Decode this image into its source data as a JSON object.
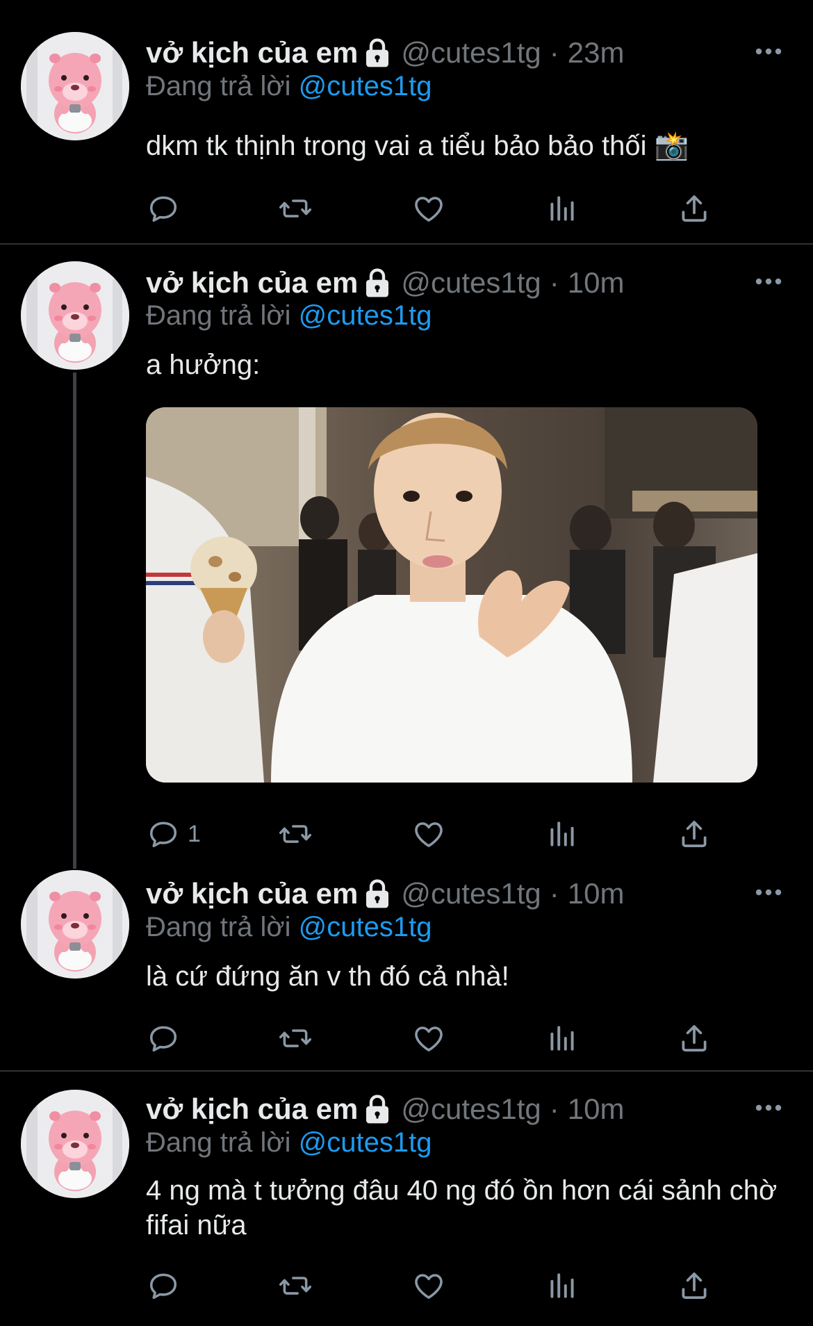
{
  "tweets": [
    {
      "display_name": "vở kịch của em",
      "handle": "@cutes1tg",
      "separator": "·",
      "time": "23m",
      "replying_prefix": "Đang trả lời",
      "replying_to": "@cutes1tg",
      "text": "dkm tk thịnh trong vai a tiểu bảo bảo thối 📸",
      "reply_count": ""
    },
    {
      "display_name": "vở kịch của em",
      "handle": "@cutes1tg",
      "separator": "·",
      "time": "10m",
      "replying_prefix": "Đang trả lời",
      "replying_to": "@cutes1tg",
      "text": "a hưởng:",
      "reply_count": "1",
      "has_media": true
    },
    {
      "display_name": "vở kịch của em",
      "handle": "@cutes1tg",
      "separator": "·",
      "time": "10m",
      "replying_prefix": "Đang trả lời",
      "replying_to": "@cutes1tg",
      "text": "là cứ đứng ăn v th đó cả nhà!",
      "reply_count": ""
    },
    {
      "display_name": "vở kịch của em",
      "handle": "@cutes1tg",
      "separator": "·",
      "time": "10m",
      "replying_prefix": "Đang trả lời",
      "replying_to": "@cutes1tg",
      "text": "4 ng mà t tưởng đâu 40 ng đó ồn hơn cái sảnh chờ fifai nữa",
      "reply_count": ""
    }
  ],
  "icons": {
    "lock": "lock-icon",
    "more": "more-icon",
    "reply": "reply-icon",
    "retweet": "retweet-icon",
    "like": "like-icon",
    "views": "views-icon",
    "share": "share-icon"
  },
  "colors": {
    "background": "#000000",
    "text": "#e7e9ea",
    "muted": "#71767b",
    "link": "#1d9bf0",
    "divider": "#2f3336"
  }
}
